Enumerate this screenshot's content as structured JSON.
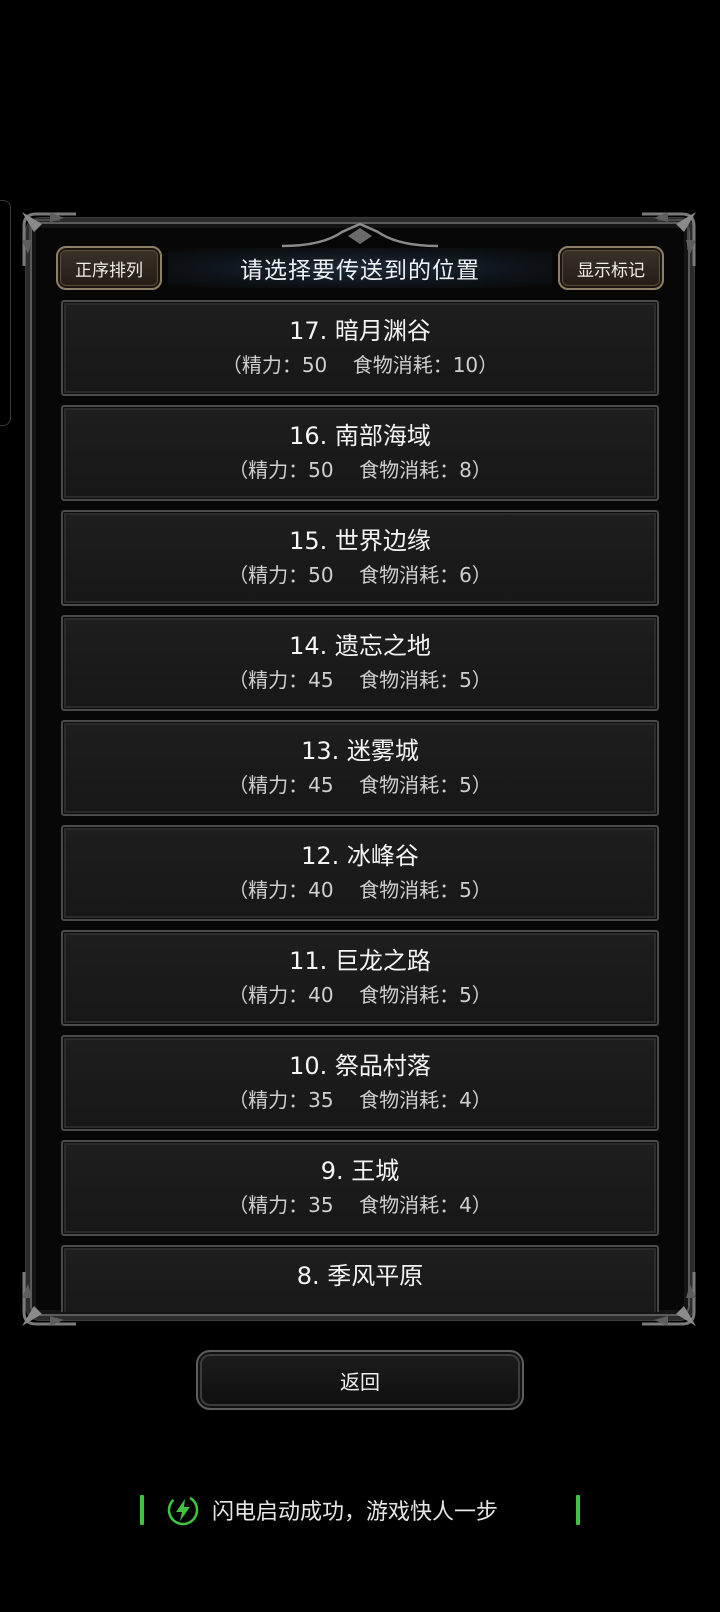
{
  "header": {
    "title": "请选择要传送到的位置",
    "sort_label": "正序排列",
    "marker_label": "显示标记"
  },
  "locations": [
    {
      "name": "17. 暗月渊谷",
      "cost": "（精力：50    食物消耗：10）"
    },
    {
      "name": "16. 南部海域",
      "cost": "（精力：50    食物消耗：8）"
    },
    {
      "name": "15. 世界边缘",
      "cost": "（精力：50    食物消耗：6）"
    },
    {
      "name": "14. 遗忘之地",
      "cost": "（精力：45    食物消耗：5）"
    },
    {
      "name": "13. 迷雾城",
      "cost": "（精力：45    食物消耗：5）"
    },
    {
      "name": "12. 冰峰谷",
      "cost": "（精力：40    食物消耗：5）"
    },
    {
      "name": "11. 巨龙之路",
      "cost": "（精力：40    食物消耗：5）"
    },
    {
      "name": "10. 祭品村落",
      "cost": "（精力：35    食物消耗：4）"
    },
    {
      "name": "9. 王城",
      "cost": "（精力：35    食物消耗：4）"
    },
    {
      "name": "8. 季风平原",
      "cost": ""
    }
  ],
  "footer": {
    "back_label": "返回"
  },
  "toast": {
    "text": "闪电启动成功，游戏快人一步",
    "accent_color": "#3fc43f"
  }
}
